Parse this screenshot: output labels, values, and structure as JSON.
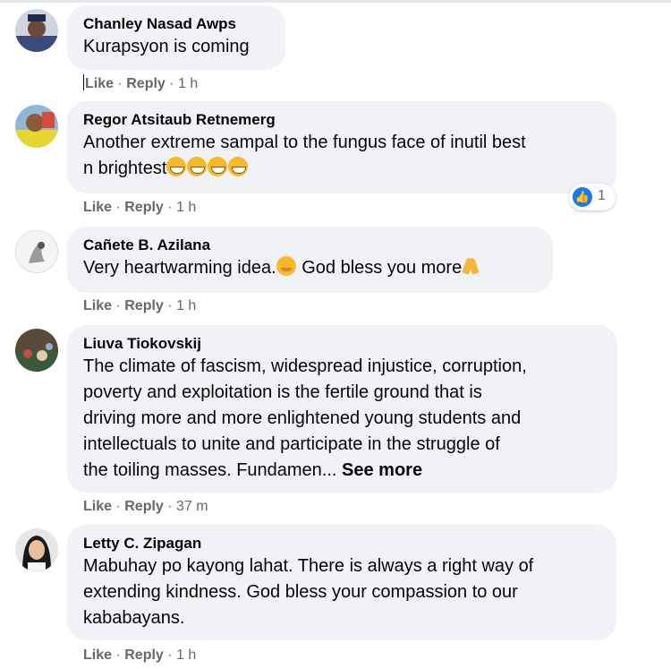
{
  "comments": [
    {
      "author": "Chanley Nasad Awps",
      "lines": [
        "Kurapsyon is coming"
      ],
      "actions": {
        "like": "Like",
        "sep": " · ",
        "reply": "Reply",
        "time": " · 1 h"
      }
    },
    {
      "author": "Regor Atsitaub Retnemerg",
      "lines": [
        "Another extreme sampal to the fungus face of inutil best",
        "n brightest"
      ],
      "emoji": [
        "grinning-squinting-face",
        "grinning-squinting-face",
        "grinning-squinting-face",
        "grinning-squinting-face"
      ],
      "reaction": {
        "icon": "like-icon",
        "count": "1"
      },
      "actions": {
        "like": "Like",
        "sep": " · ",
        "reply": "Reply",
        "time": " · 1 h"
      }
    },
    {
      "author": "Cañete B. Azilana",
      "text_a": "Very heartwarming idea.",
      "text_b": " God bless you more",
      "emoji": [
        "hugging-face",
        "folded-hands"
      ],
      "actions": {
        "like": "Like",
        "sep": " · ",
        "reply": "Reply",
        "time": " · 1 h"
      }
    },
    {
      "author": "Liuva Tiokovskij",
      "lines": [
        "The climate of fascism, widespread injustice, corruption,",
        "poverty and exploitation is the fertile ground that is",
        "driving more and more enlightened young students and",
        "intellectuals to unite and participate in the struggle of",
        "the toiling masses. Fundamen..."
      ],
      "see_more": " See more",
      "actions": {
        "like": "Like",
        "sep": " · ",
        "reply": "Reply",
        "time": " · 37 m"
      }
    },
    {
      "author": "Letty C. Zipagan",
      "lines": [
        "Mabuhay po kayong lahat. There is always a right way of",
        "extending kindness. God bless your compassion to our",
        "kababayans."
      ],
      "actions": {
        "like": "Like",
        "sep": " · ",
        "reply": "Reply",
        "time": " · 1 h"
      }
    }
  ]
}
